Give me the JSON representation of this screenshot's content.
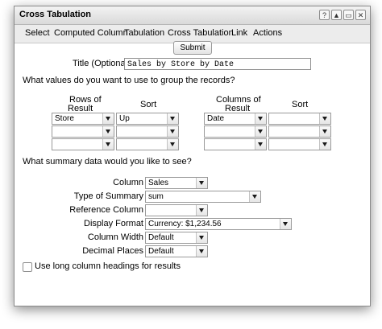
{
  "window": {
    "title": "Cross Tabulation",
    "controls": [
      "?",
      "▲",
      "▭",
      "✕"
    ]
  },
  "menu": [
    "Select",
    "Computed Column",
    "Tabulation",
    "Cross Tabulation",
    "Link",
    "Actions"
  ],
  "submit_label": "Submit",
  "title_field": {
    "label": "Title (Optional)",
    "value": "Sales by Store by Date"
  },
  "group_prompt": "What values do you want to use to group the records?",
  "rows_header": {
    "line1": "Rows of",
    "line2": "Result"
  },
  "columns_header": {
    "line1": "Columns of",
    "line2": "Result"
  },
  "sort_header": "Sort",
  "rows": [
    {
      "field": "Store",
      "sort": "Up"
    },
    {
      "field": "",
      "sort": ""
    },
    {
      "field": "",
      "sort": ""
    }
  ],
  "columns": [
    {
      "field": "Date",
      "sort": ""
    },
    {
      "field": "",
      "sort": ""
    },
    {
      "field": "",
      "sort": ""
    }
  ],
  "summary_prompt": "What summary data would you like to see?",
  "summary": {
    "column": {
      "label": "Column",
      "value": "Sales"
    },
    "type": {
      "label": "Type of Summary",
      "value": "sum"
    },
    "reference": {
      "label": "Reference Column",
      "value": ""
    },
    "format": {
      "label": "Display Format",
      "value": "Currency: $1,234.56"
    },
    "width": {
      "label": "Column Width",
      "value": "Default"
    },
    "decimals": {
      "label": "Decimal Places",
      "value": "Default"
    }
  },
  "long_headings": {
    "label": "Use long column headings for results",
    "checked": false
  }
}
